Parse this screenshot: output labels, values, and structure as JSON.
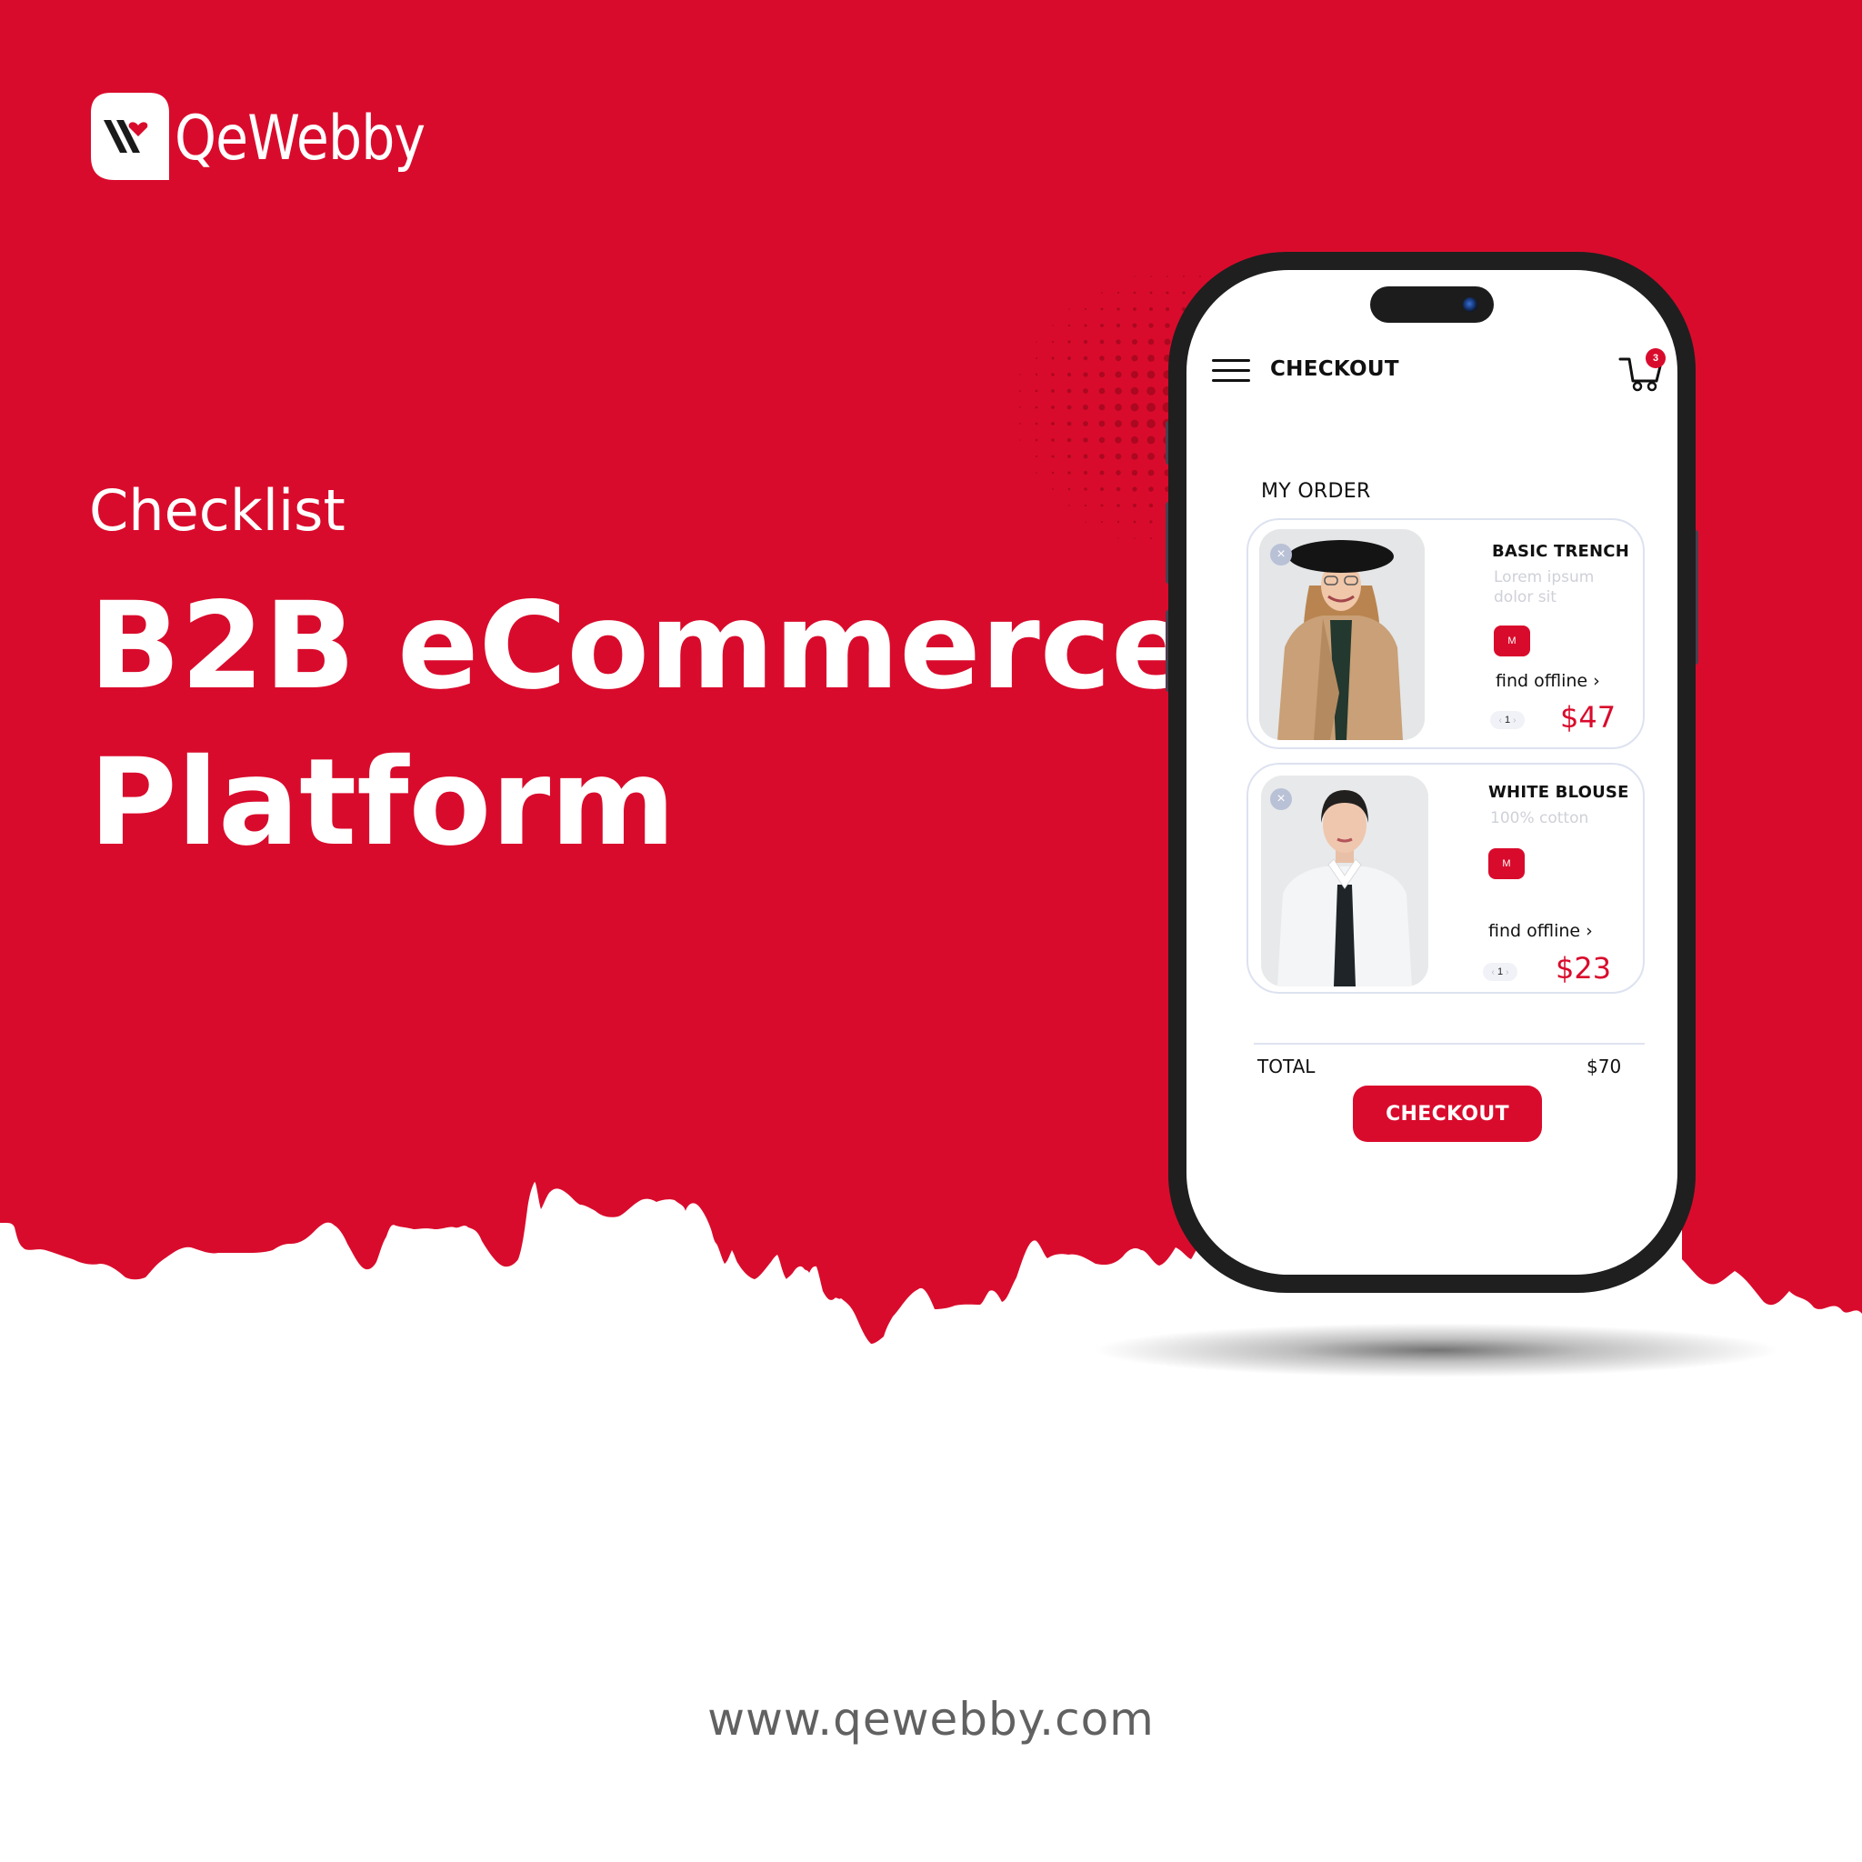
{
  "colors": {
    "brand_red": "#D90B2C",
    "phone_frame": "#1F1F1F",
    "halftone_dot": "#A3081F",
    "url_text": "#616161",
    "card_border": "#DDE2F0",
    "muted_text": "#CFD1D8"
  },
  "brand": {
    "name": "QeWebby",
    "logo_icon": "qewebby-logo-icon"
  },
  "hero": {
    "eyebrow": "Checklist",
    "headline_line1": "B2B eCommerce",
    "headline_line2": "Platform"
  },
  "footer": {
    "url": "www.qewebby.com"
  },
  "phone_app": {
    "header": {
      "menu_icon": "hamburger-menu-icon",
      "title": "CHECKOUT",
      "cart_icon": "shopping-cart-icon",
      "cart_count": "3"
    },
    "section_title": "MY ORDER",
    "items": [
      {
        "name": "BASIC TRENCH",
        "description": "Lorem ipsum dolor sit",
        "size": "M",
        "link_label": "find offline",
        "link_chevron": "›",
        "quantity": "1",
        "price": "$47",
        "remove_icon": "×",
        "image": "woman-in-hat-and-camel-trench-coat"
      },
      {
        "name": "WHITE BLOUSE",
        "description": "100% cotton",
        "size": "M",
        "link_label": "find offline",
        "link_chevron": "›",
        "quantity": "1",
        "price": "$23",
        "remove_icon": "×",
        "image": "woman-in-white-blouse"
      }
    ],
    "total_label": "TOTAL",
    "total_value": "$70",
    "checkout_button": "CHECKOUT"
  }
}
